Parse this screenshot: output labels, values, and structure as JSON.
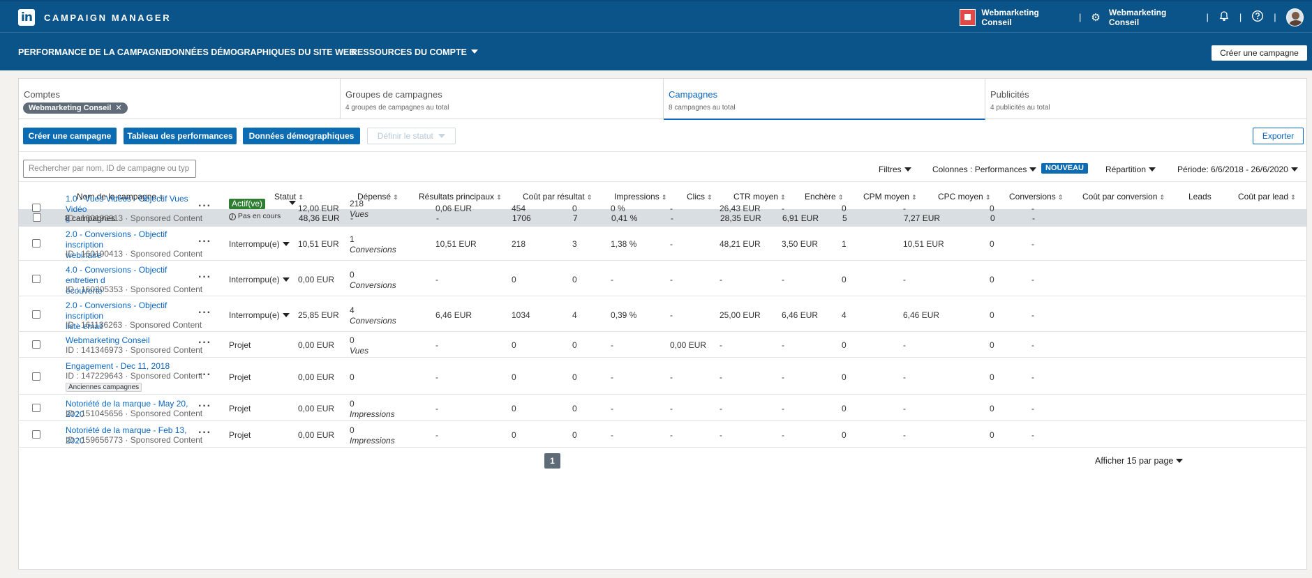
{
  "header": {
    "logo_text": "in",
    "app_title": "CAMPAIGN MANAGER",
    "account_name": "Webmarketing Conseil",
    "settings_account": "Webmarketing Conseil"
  },
  "nav": {
    "performance": "PERFORMANCE DE LA CAMPAGNE",
    "demographics": "DONNÉES DÉMOGRAPHIQUES DU SITE WEB",
    "resources": "RESSOURCES DU COMPTE",
    "create": "Créer une campagne"
  },
  "tabs": {
    "accounts": {
      "title": "Comptes",
      "filter": "Webmarketing Conseil"
    },
    "groups": {
      "title": "Groupes de campagnes",
      "sub": "4 groupes de campagnes au total"
    },
    "campaigns": {
      "title": "Campagnes",
      "sub": "8 campagnes au total"
    },
    "ads": {
      "title": "Publicités",
      "sub": "4 publicités au total"
    }
  },
  "actions": {
    "create": "Créer une campagne",
    "performance_chart": "Tableau des performances",
    "demographics": "Données démographiques",
    "set_status": "Définir le statut",
    "export": "Exporter"
  },
  "toolbar": {
    "search_placeholder": "Rechercher par nom, ID de campagne ou typ",
    "filters": "Filtres",
    "columns_label": "Colonnes :",
    "columns_value": "Performances",
    "new_badge": "NOUVEAU",
    "breakdown": "Répartition",
    "period": "Période: 6/6/2018 - 26/6/2020"
  },
  "columns": {
    "name": "Nom de la campagne",
    "status": "Statut",
    "spent": "Dépensé",
    "results": "Résultats principaux",
    "cost_per_result": "Coût par résultat",
    "impressions": "Impressions",
    "clicks": "Clics",
    "ctr": "CTR moyen",
    "bid": "Enchère",
    "cpm": "CPM moyen",
    "cpc": "CPC moyen",
    "conversions": "Conversions",
    "cost_per_conversion": "Coût par conversion",
    "leads": "Leads",
    "cost_per_lead": "Coût par lead"
  },
  "totals": {
    "name": "8 campagnes",
    "status": "-",
    "spent": "48,36 EUR",
    "results": "-",
    "cost_per_result": "-",
    "impressions": "1706",
    "clicks": "7",
    "ctr": "0,41 %",
    "bid": "-",
    "cpm": "28,35 EUR",
    "cpc": "6,91 EUR",
    "conversions": "5",
    "cost_per_conversion": "7,27 EUR",
    "leads": "0",
    "cost_per_lead": "-"
  },
  "rows": [
    {
      "name_l1": "1.0 - Vues Vidéos - Objectif Vues Vidéo",
      "name_l2": "s",
      "meta": "ID : 160198913 · Sponsored Content",
      "status": "Actif(ve)",
      "status_note": "Pas en cours",
      "spent": "12,00 EUR",
      "res_value": "218",
      "res_unit": "Vues",
      "cost_per_result": "0,06 EUR",
      "impressions": "454",
      "clicks": "0",
      "ctr": "0 %",
      "bid": "-",
      "cpm": "26,43 EUR",
      "cpc": "-",
      "conversions": "0",
      "cost_per_conversion": "-",
      "leads": "0",
      "cost_per_lead": "-"
    },
    {
      "name_l1": "2.0 - Conversions - Objectif inscription",
      "name_l2": "webinaire",
      "meta": "ID : 160190413 · Sponsored Content",
      "status": "Interrompu(e)",
      "spent": "10,51 EUR",
      "res_value": "1",
      "res_unit": "Conversions",
      "cost_per_result": "10,51 EUR",
      "impressions": "218",
      "clicks": "3",
      "ctr": "1,38 %",
      "bid": "-",
      "cpm": "48,21 EUR",
      "cpc": "3,50 EUR",
      "conversions": "1",
      "cost_per_conversion": "10,51 EUR",
      "leads": "0",
      "cost_per_lead": "-"
    },
    {
      "name_l1": "4.0 - Conversions - Objectif entretien d",
      "name_l2": "écouverte",
      "meta": "ID : 160205353 · Sponsored Content",
      "status": "Interrompu(e)",
      "spent": "0,00 EUR",
      "res_value": "0",
      "res_unit": "Conversions",
      "cost_per_result": "-",
      "impressions": "0",
      "clicks": "0",
      "ctr": "-",
      "bid": "-",
      "cpm": "-",
      "cpc": "-",
      "conversions": "0",
      "cost_per_conversion": "-",
      "leads": "0",
      "cost_per_lead": "-"
    },
    {
      "name_l1": "2.0 - Conversions - Objectif inscription",
      "name_l2": "liste email",
      "meta": "ID : 161136263 · Sponsored Content",
      "status": "Interrompu(e)",
      "spent": "25,85 EUR",
      "res_value": "4",
      "res_unit": "Conversions",
      "cost_per_result": "6,46 EUR",
      "impressions": "1034",
      "clicks": "4",
      "ctr": "0,39 %",
      "bid": "-",
      "cpm": "25,00 EUR",
      "cpc": "6,46 EUR",
      "conversions": "4",
      "cost_per_conversion": "6,46 EUR",
      "leads": "0",
      "cost_per_lead": "-"
    },
    {
      "name_l1": "Webmarketing Conseil",
      "name_l2": "",
      "meta": "ID : 141346973 · Sponsored Content",
      "status": "Projet",
      "spent": "0,00 EUR",
      "res_value": "0",
      "res_unit": "Vues",
      "cost_per_result": "-",
      "impressions": "0",
      "clicks": "0",
      "ctr": "-",
      "bid": "0,00 EUR",
      "cpm": "-",
      "cpc": "-",
      "conversions": "0",
      "cost_per_conversion": "-",
      "leads": "0",
      "cost_per_lead": "-"
    },
    {
      "name_l1": "Engagement - Dec 11, 2018",
      "name_l2": "",
      "meta": "ID : 147229643 · Sponsored Content",
      "tag": "Anciennes campagnes",
      "status": "Projet",
      "spent": "0,00 EUR",
      "res_value": "0",
      "res_unit": "",
      "cost_per_result": "-",
      "impressions": "0",
      "clicks": "0",
      "ctr": "-",
      "bid": "-",
      "cpm": "-",
      "cpc": "-",
      "conversions": "0",
      "cost_per_conversion": "-",
      "leads": "0",
      "cost_per_lead": "-"
    },
    {
      "name_l1": "Notoriété de la marque - May 20, 2020",
      "name_l2": "",
      "meta": "ID : 151045656 · Sponsored Content",
      "status": "Projet",
      "spent": "0,00 EUR",
      "res_value": "0",
      "res_unit": "Impressions",
      "cost_per_result": "-",
      "impressions": "0",
      "clicks": "0",
      "ctr": "-",
      "bid": "-",
      "cpm": "-",
      "cpc": "-",
      "conversions": "0",
      "cost_per_conversion": "-",
      "leads": "0",
      "cost_per_lead": "-"
    },
    {
      "name_l1": "Notoriété de la marque - Feb 13, 2020",
      "name_l2": "",
      "meta": "ID : 159656773 · Sponsored Content",
      "status": "Projet",
      "spent": "0,00 EUR",
      "res_value": "0",
      "res_unit": "Impressions",
      "cost_per_result": "-",
      "impressions": "0",
      "clicks": "0",
      "ctr": "-",
      "bid": "-",
      "cpm": "-",
      "cpc": "-",
      "conversions": "0",
      "cost_per_conversion": "-",
      "leads": "0",
      "cost_per_lead": "-"
    }
  ],
  "pagination": {
    "page": "1",
    "per_page": "Afficher 15 par page"
  },
  "colors": {
    "brand": "#0b5489",
    "accent": "#0a66c2",
    "active": "#2e7d32"
  }
}
